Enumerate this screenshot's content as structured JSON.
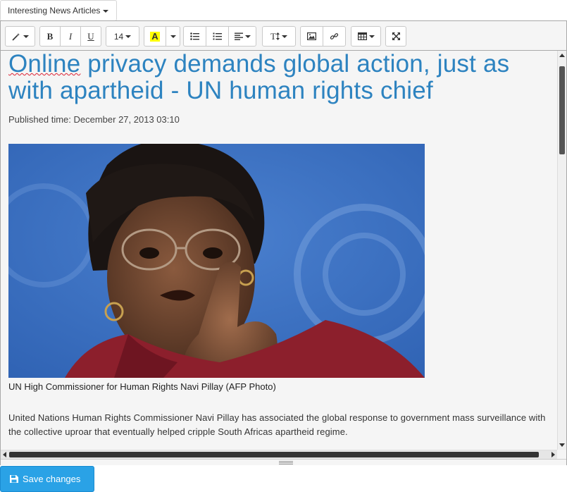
{
  "collection_dropdown": {
    "label": "Interesting News Articles"
  },
  "toolbar": {
    "font_size": "14",
    "text_style_label": "T",
    "bold_label": "B",
    "italic_label": "I",
    "underline_label": "U",
    "color_letter": "A"
  },
  "article": {
    "title_word1": "Online",
    "title_rest": " privacy demands global action, just as with apartheid - UN human rights chief",
    "published": "Published time: December 27, 2013 03:10",
    "photo_caption": "UN High Commissioner for Human Rights Navi Pillay (AFP Photo)",
    "body": "United Nations Human Rights Commissioner Navi Pillay has associated the global response to government mass surveillance with the collective uproar that eventually helped cripple South Africas apartheid regime."
  },
  "footer": {
    "save_label": "Save changes"
  }
}
